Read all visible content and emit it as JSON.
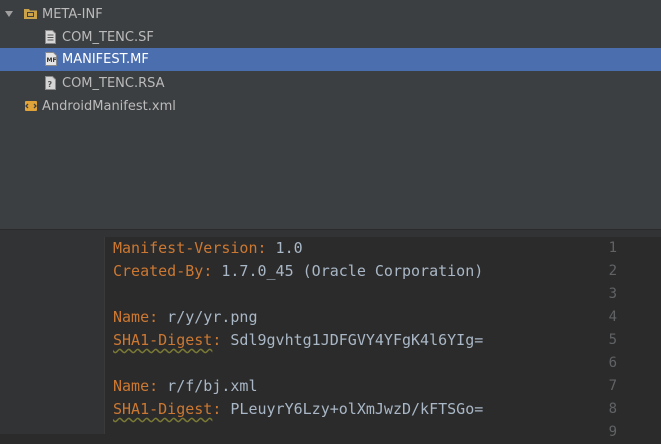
{
  "tree": {
    "items": [
      {
        "label": "META-INF",
        "icon": "folder-icon",
        "expanded": true
      },
      {
        "label": "COM_TENC.SF",
        "icon": "file-text-icon"
      },
      {
        "label": "MANIFEST.MF",
        "icon": "manifest-file-icon",
        "selected": true
      },
      {
        "label": "COM_TENC.RSA",
        "icon": "unknown-file-icon"
      },
      {
        "label": "AndroidManifest.xml",
        "icon": "xml-file-icon"
      }
    ]
  },
  "editor": {
    "lines": [
      {
        "num": "1",
        "key": "Manifest-Version",
        "value": " 1.0"
      },
      {
        "num": "2",
        "key": "Created-By",
        "value": " 1.7.0_45 (Oracle Corporation)"
      },
      {
        "num": "3",
        "key": "",
        "value": ""
      },
      {
        "num": "4",
        "key": "Name",
        "value": " r/y/yr.png"
      },
      {
        "num": "5",
        "key": "SHA1-Digest",
        "value": " Sdl9gvhtg1JDFGVY4YFgK4l6YIg="
      },
      {
        "num": "6",
        "key": "",
        "value": ""
      },
      {
        "num": "7",
        "key": "Name",
        "value": " r/f/bj.xml"
      },
      {
        "num": "8",
        "key": "SHA1-Digest",
        "value": " PLeuyrY6Lzy+olXmJwzD/kFTSGo="
      },
      {
        "num": "9",
        "key": "",
        "value": ""
      }
    ]
  },
  "colors": {
    "tree_bg": "#3c3f41",
    "selection": "#4b6eaf",
    "editor_bg": "#2b2b2b",
    "key": "#cc7832",
    "value": "#a9b7c6"
  }
}
